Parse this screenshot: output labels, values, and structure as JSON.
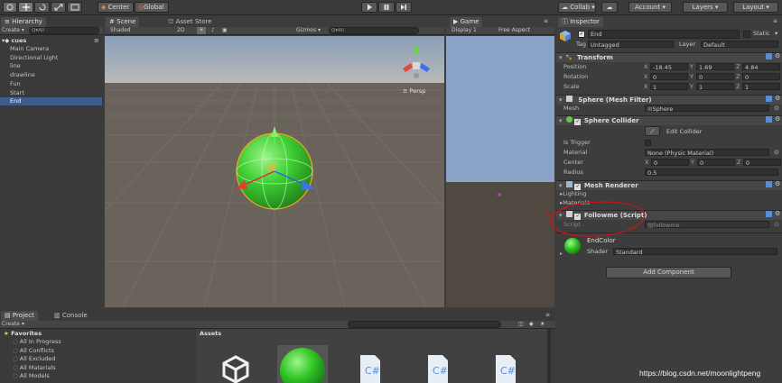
{
  "toolbar": {
    "center_label": "Center",
    "global_label": "Global",
    "collab_label": "Collab ▾",
    "account_label": "Account",
    "layers_label": "Layers",
    "layout_label": "Layout"
  },
  "hierarchy": {
    "tab": "Hierarchy",
    "create": "Create ▾",
    "search": "Q▾All",
    "scene_name": "cues",
    "items": [
      "Main Camera",
      "Directional Light",
      "line",
      "drawline",
      "Fun",
      "Start",
      "End"
    ],
    "selected_index": 6
  },
  "scene": {
    "tab": "Scene",
    "asset_store_tab": "Asset Store",
    "shading": "Shaded",
    "mode_2d": "2D",
    "gizmos": "Gizmos ▾",
    "search": "Q▾All",
    "persp": "≡ Persp"
  },
  "game": {
    "tab": "Game",
    "display": "Display 1",
    "aspect": "Free Aspect"
  },
  "inspector": {
    "tab": "Inspector",
    "object_name": "End",
    "static_label": "Static",
    "tag_label": "Tag",
    "tag_value": "Untagged",
    "layer_label": "Layer",
    "layer_value": "Default",
    "transform": {
      "title": "Transform",
      "position_label": "Position",
      "rotation_label": "Rotation",
      "scale_label": "Scale",
      "position": [
        "-18.45",
        "1.69",
        "4.84"
      ],
      "rotation": [
        "0",
        "0",
        "0"
      ],
      "scale": [
        "1",
        "1",
        "1"
      ]
    },
    "mesh_filter": {
      "title": "Sphere (Mesh Filter)",
      "mesh_label": "Mesh",
      "mesh_value": "Sphere"
    },
    "sphere_collider": {
      "title": "Sphere Collider",
      "edit_label": "Edit Collider",
      "is_trigger_label": "Is Trigger",
      "material_label": "Material",
      "material_value": "None (Physic Material)",
      "center_label": "Center",
      "center": [
        "0",
        "0",
        "0"
      ],
      "radius_label": "Radius",
      "radius": "0.5"
    },
    "mesh_renderer": {
      "title": "Mesh Renderer",
      "lighting": "Lighting",
      "materials": "Materials"
    },
    "followme": {
      "title": "Followme (Script)",
      "script_label": "Script",
      "script_value": "followme"
    },
    "material": {
      "name": "EndColor",
      "shader_label": "Shader",
      "shader_value": "Standard"
    },
    "add_component": "Add Component"
  },
  "project": {
    "tab": "Project",
    "console_tab": "Console",
    "create": "Create ▾",
    "favorites_title": "Favorites",
    "favorites": [
      "All In Progress",
      "All Conflicts",
      "All Excluded",
      "All Materials",
      "All Models"
    ],
    "assets_header": "Assets"
  },
  "axis_labels": {
    "x": "X",
    "y": "Y",
    "z": "Z"
  },
  "watermark": "https://blog.csdn.net/moonlightpeng",
  "colors": {
    "selection": "#3d5e8c",
    "sphere": "#44d43a",
    "annotation": "#c81414",
    "panel_bg": "#3a3a3a"
  }
}
